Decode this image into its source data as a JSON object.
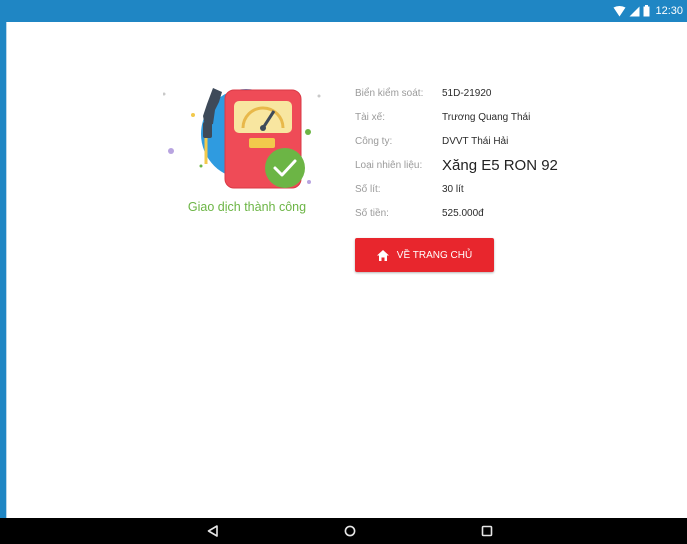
{
  "status_bar": {
    "time": "12:30",
    "icons": [
      "wifi-icon",
      "cell-signal-icon",
      "battery-icon"
    ]
  },
  "illustration": {
    "icon": "fuel-pump-success-icon",
    "caption": "Giao dịch thành công"
  },
  "details": {
    "rows": [
      {
        "label": "Biển kiểm soát:",
        "value": "51D-21920"
      },
      {
        "label": "Tài xế:",
        "value": "Trương Quang Thái"
      },
      {
        "label": "Công ty:",
        "value": "DVVT Thái Hải"
      },
      {
        "label": "Loại nhiên liệu:",
        "value": "Xăng E5 RON 92"
      },
      {
        "label": "Số lít:",
        "value": "30 lít"
      },
      {
        "label": "Số tiền:",
        "value": "525.000đ"
      }
    ]
  },
  "home_button": {
    "label": "VỀ TRANG CHỦ",
    "icon": "home-icon"
  },
  "nav_bar": {
    "buttons": [
      "back-icon",
      "home-circle-icon",
      "recents-icon"
    ]
  },
  "colors": {
    "status_bar": "#1f86c4",
    "success_green": "#6cb545",
    "button_red": "#e8262d",
    "pump_red": "#ef4b57",
    "accent_blue": "#2f9be0"
  }
}
